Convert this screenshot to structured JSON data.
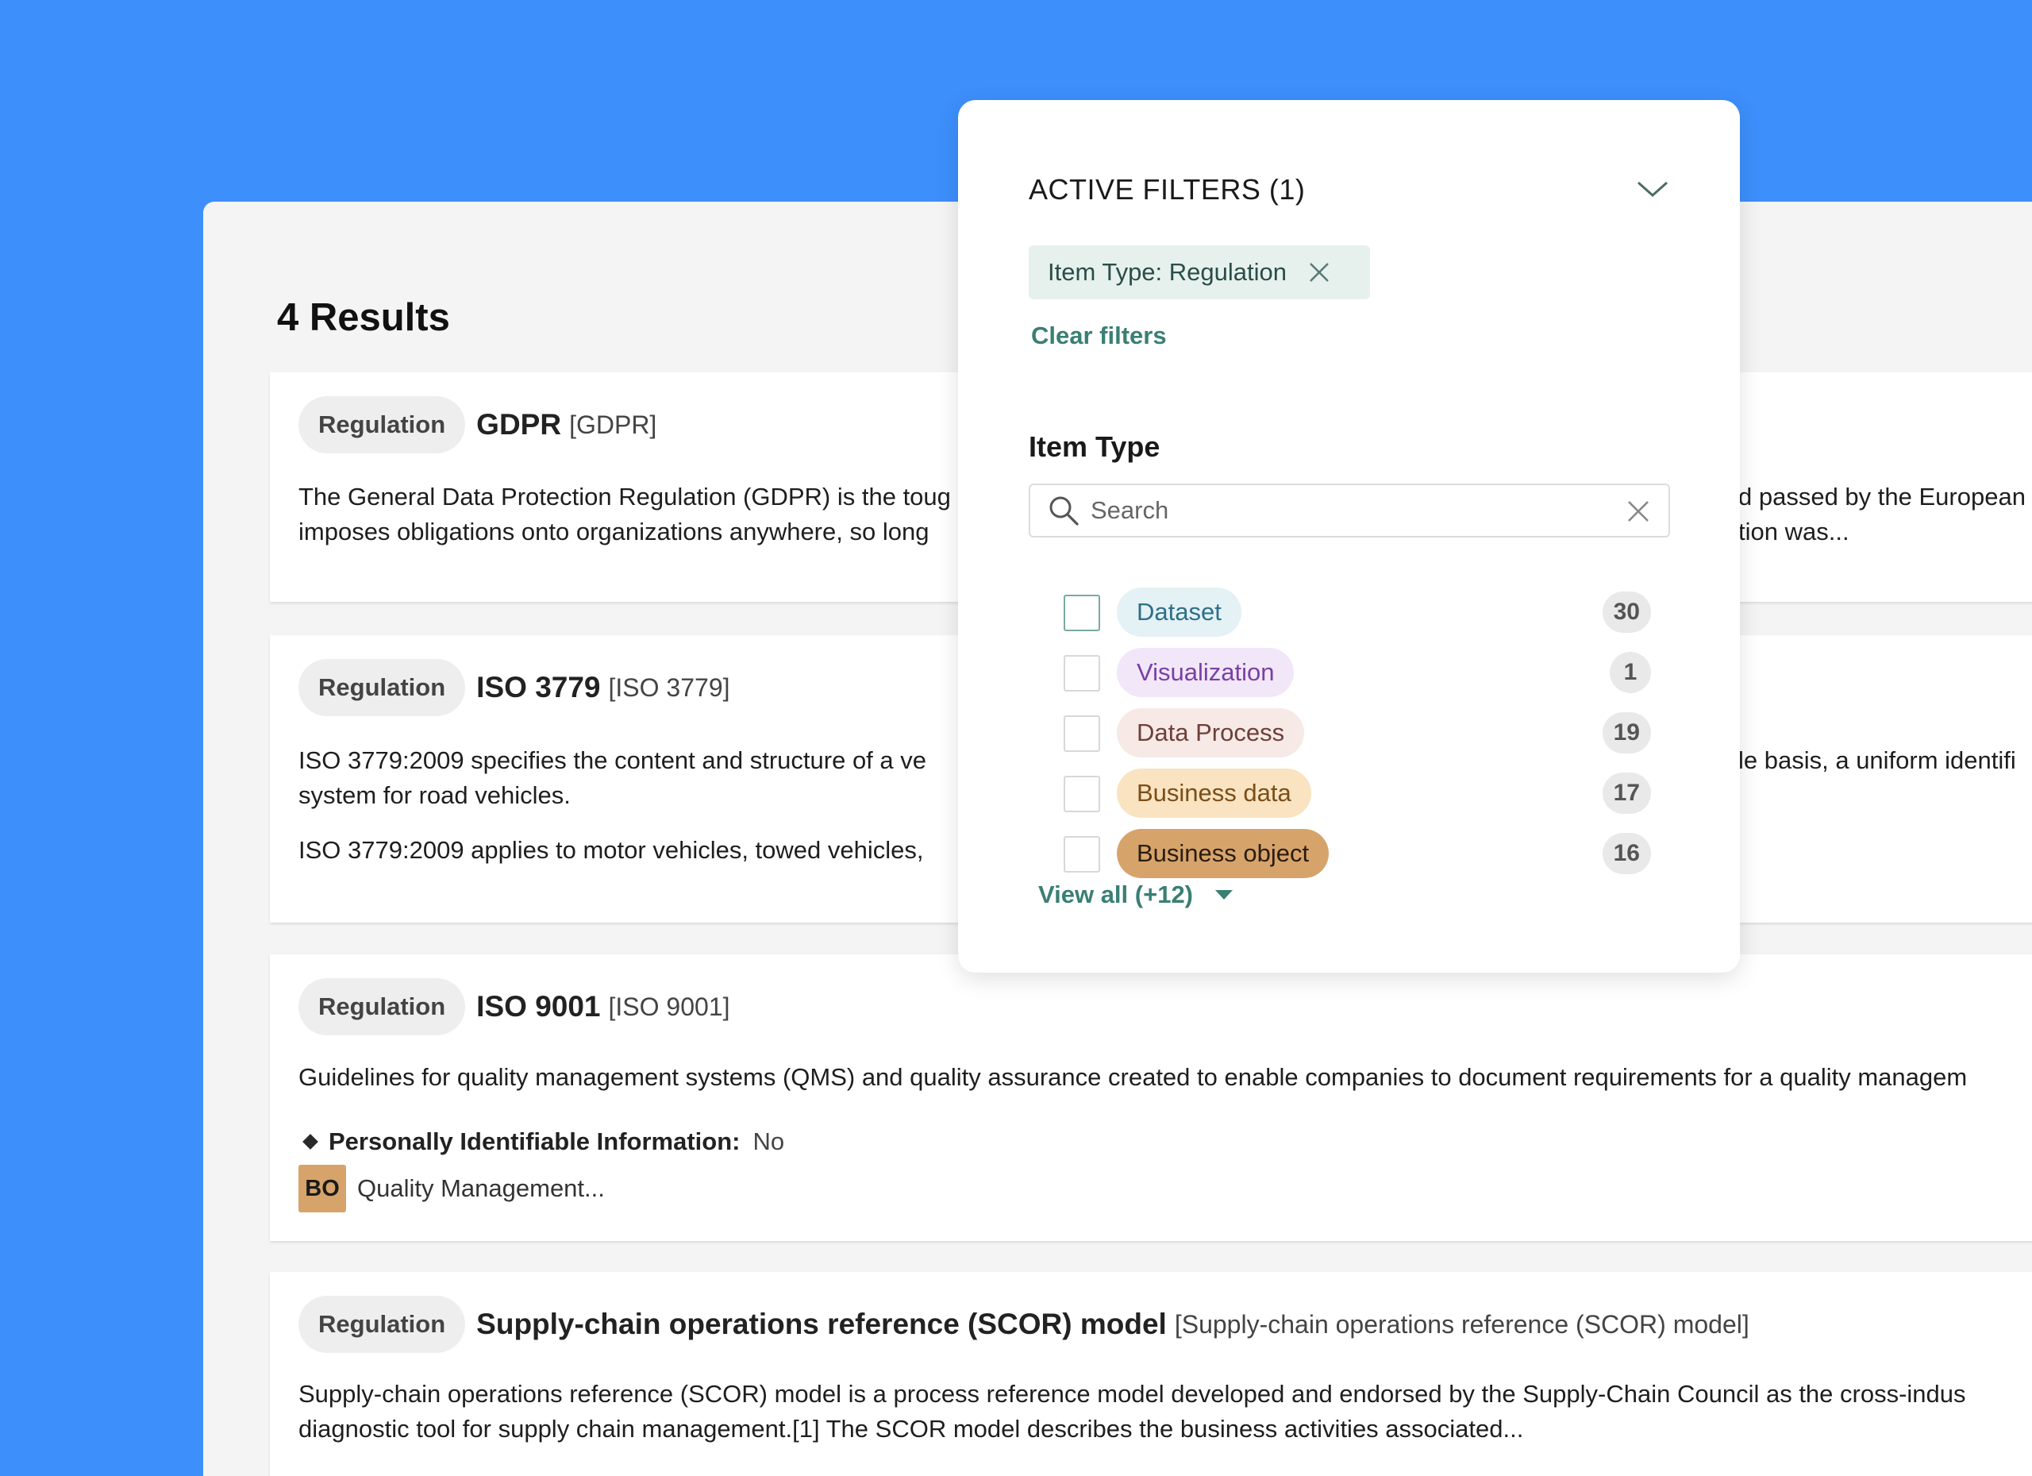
{
  "results": {
    "title": "4 Results",
    "cards": [
      {
        "type": "Regulation",
        "title": "GDPR",
        "code": "[GDPR]",
        "desc": [
          "The General Data Protection Regulation (GDPR) is the toug",
          "imposes obligations onto organizations anywhere, so long"
        ],
        "desc_right": [
          "d passed by the European",
          "tion was..."
        ]
      },
      {
        "type": "Regulation",
        "title": "ISO 3779",
        "code": "[ISO 3779]",
        "desc": [
          "ISO 3779:2009 specifies the content and structure of a ve",
          "system for road vehicles.",
          "ISO 3779:2009 applies to motor vehicles, towed vehicles,"
        ],
        "desc_right": [
          "le basis, a uniform identifi"
        ]
      },
      {
        "type": "Regulation",
        "title": "ISO 9001",
        "code": "[ISO 9001]",
        "desc": [
          "Guidelines for quality management systems (QMS) and quality assurance created to enable companies to document requirements for a quality managem"
        ],
        "pii_label": "Personally Identifiable Information:",
        "pii_value": "No",
        "bo_badge": "BO",
        "bo_text": "Quality Management..."
      },
      {
        "type": "Regulation",
        "title": "Supply-chain operations reference (SCOR) model",
        "code": "[Supply-chain operations reference (SCOR) model]",
        "desc": [
          "Supply-chain operations reference (SCOR) model is a process reference model developed and endorsed by the Supply-Chain Council as the cross-indus",
          "diagnostic tool for supply chain management.[1] The SCOR model describes the business activities associated..."
        ]
      }
    ]
  },
  "filters": {
    "title": "ACTIVE FILTERS (1)",
    "chip_label": "Item Type: Regulation",
    "clear_label": "Clear filters",
    "section_title": "Item Type",
    "search_placeholder": "Search",
    "options": [
      {
        "label": "Dataset",
        "count": "30",
        "color": "#2e6f88",
        "bg": "#e4f1f5"
      },
      {
        "label": "Visualization",
        "count": "1",
        "color": "#7a3fa5",
        "bg": "#f1e7f8"
      },
      {
        "label": "Data Process",
        "count": "19",
        "color": "#6e3f38",
        "bg": "#f6e9e6"
      },
      {
        "label": "Business data",
        "count": "17",
        "color": "#7a4e1a",
        "bg": "#f9e3c0"
      },
      {
        "label": "Business object",
        "count": "16",
        "color": "#2b1c0c",
        "bg": "#d6a46b"
      }
    ],
    "view_all_label": "View all (+12)"
  }
}
